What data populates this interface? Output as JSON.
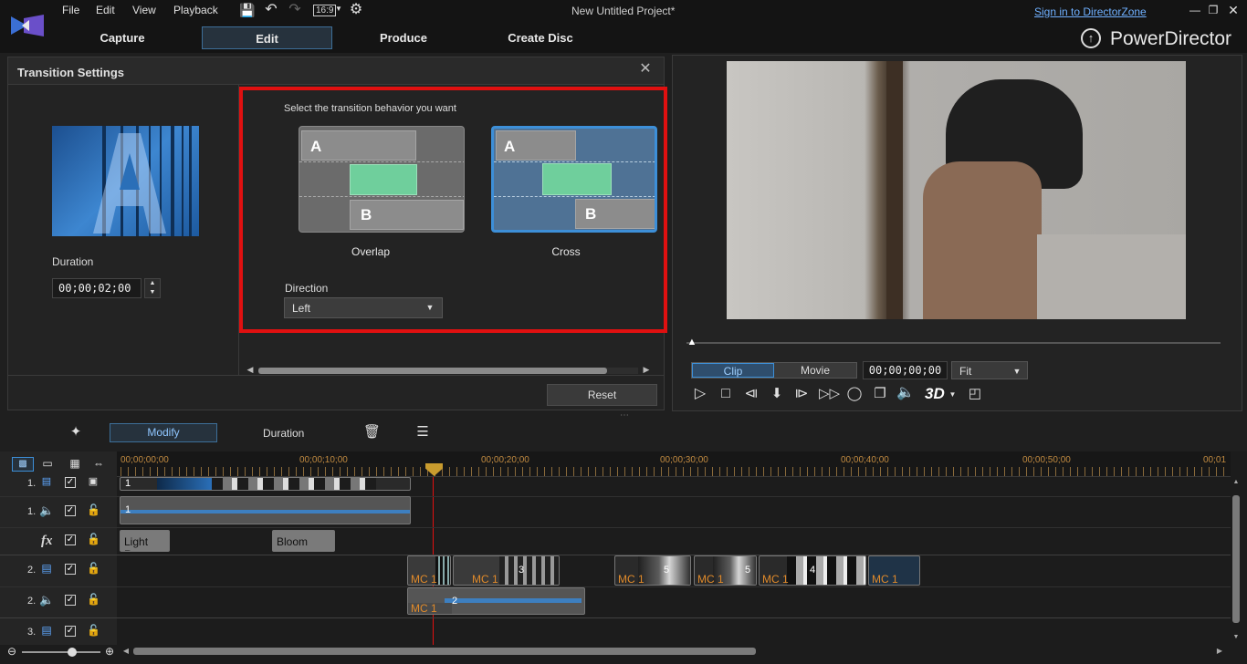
{
  "app": {
    "title": "New Untitled Project*",
    "brand": "PowerDirector",
    "signin": "Sign in to DirectorZone",
    "aspect": "16:9"
  },
  "menu": [
    "File",
    "Edit",
    "View",
    "Playback"
  ],
  "tabs": [
    "Capture",
    "Edit",
    "Produce",
    "Create Disc"
  ],
  "transition": {
    "title": "Transition Settings",
    "prompt": "Select the transition behavior you want",
    "duration_label": "Duration",
    "duration_value": "00;00;02;00",
    "options": [
      {
        "label": "Overlap",
        "a": "A",
        "b": "B"
      },
      {
        "label": "Cross",
        "a": "A",
        "b": "B"
      }
    ],
    "direction_label": "Direction",
    "direction_value": "Left",
    "reset_label": "Reset"
  },
  "preview": {
    "mode_clip": "Clip",
    "mode_movie": "Movie",
    "timecode": "00;00;00;00",
    "zoom": "Fit",
    "threed": "3D"
  },
  "toolbar": {
    "modify": "Modify",
    "duration": "Duration"
  },
  "timeline": {
    "ruler": [
      "00;00;00;00",
      "00;00;10;00",
      "00;00;20;00",
      "00;00;30;00",
      "00;00;40;00",
      "00;00;50;00",
      "00;01"
    ],
    "tracks": [
      {
        "label": "1."
      },
      {
        "label": "1."
      },
      {
        "label": "fx"
      },
      {
        "label": "2."
      },
      {
        "label": "2."
      },
      {
        "label": "3."
      }
    ],
    "fx_clips": [
      "Light Ray",
      "Bloom"
    ],
    "clips": {
      "t1_num": "1",
      "t1a_num": "1",
      "mc": "MC 1",
      "n3": "3",
      "n5a": "5",
      "n5b": "5",
      "n4": "4",
      "n2": "2"
    }
  },
  "colors": {
    "accent": "#3d8fd8",
    "highlight": "#e01010",
    "clip_text": "#e08a2a"
  }
}
